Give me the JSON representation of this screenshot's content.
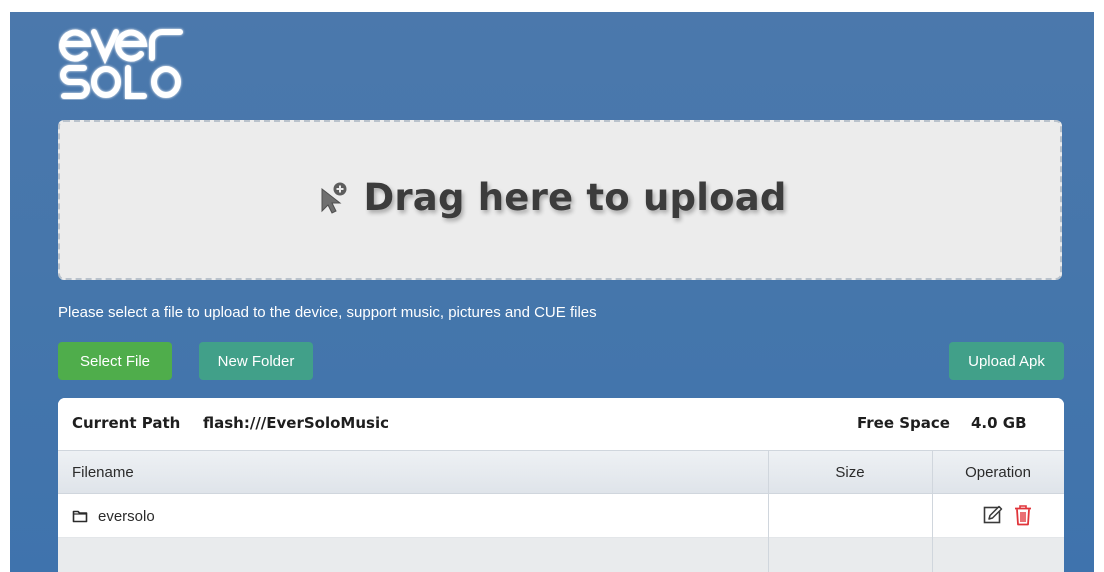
{
  "brand": {
    "logo_text_line1": "ever",
    "logo_text_line2": "SOLO"
  },
  "upload": {
    "drop_text": "Drag here to upload",
    "drop_icon": "pointer-plus-icon",
    "hint": "Please select a file to upload to the device, support music, pictures and CUE files"
  },
  "toolbar": {
    "select_file": "Select File",
    "new_folder": "New Folder",
    "upload_apk": "Upload Apk"
  },
  "pathbar": {
    "current_path_label": "Current Path",
    "current_path_value": "flash:///EverSoloMusic",
    "free_space_label": "Free Space",
    "free_space_value": "4.0 GB"
  },
  "table": {
    "columns": [
      "Filename",
      "Size",
      "Operation"
    ],
    "rows": [
      {
        "icon": "folder-icon",
        "name": "eversolo",
        "size": "",
        "operations": [
          "edit-icon",
          "trash-icon"
        ]
      }
    ]
  },
  "colors": {
    "panel": "#4576ab",
    "select_button": "#4fad4b",
    "teal_button": "#41a089",
    "delete_icon": "#e0343a"
  }
}
